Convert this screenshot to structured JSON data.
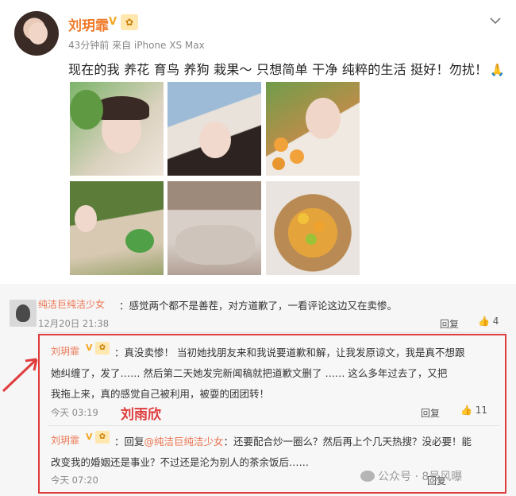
{
  "post": {
    "username": "刘玥霏",
    "verified_badge": "V",
    "medal": "✿",
    "meta": "43分钟前 来自 iPhone XS Max",
    "text": "现在的我 养花 育鸟 养狗 栽果～ 只想简单 干净 纯粹的生活 挺好！勿扰！",
    "emoji": "🙏",
    "more_icon": "chevron-down-icon",
    "photo_count": 6
  },
  "comments": {
    "first": {
      "name": "纯洁巨纯洁少女",
      "text": "：感觉两个都不是善茬，对方道歉了，一看评论这边又在卖惨。",
      "time": "12月20日 21:38",
      "reply": "回复",
      "likes": "4"
    },
    "reply": {
      "name": "刘玥霏",
      "badge": "V",
      "medal": "✿",
      "line1": "：真没卖惨！ 当初她找朋友来和我说要道歉和解，让我发原谅文，我是真不想跟",
      "line2": "她纠缠了，发了…… 然后第二天她发完新闻稿就把道歉文删了 …… 这么多年过去了，又把",
      "line3": "我拖上来，真的感觉自己被利用，被耍的团团转！",
      "time": "今天 03:19",
      "overlay": "刘雨欣",
      "reply": "回复",
      "likes": "11"
    },
    "second_reply": {
      "name": "刘玥霏",
      "badge": "V",
      "medal": "✿",
      "prefix": "：回复",
      "mention": "@纯洁巨纯洁少女",
      "line1_rest": "：还要配合炒一圈么？然后再上个几天热搜？没必要！能",
      "line2": "改变我的婚姻还是事业？不过还是沦为别人的茶余饭后……",
      "time": "今天 07:20",
      "reply": "回复"
    },
    "watermark": "公众号 · 8号风曝"
  },
  "colors": {
    "username": "#f07a2a",
    "comment_name": "#eb7350",
    "highlight": "#e03c3c"
  }
}
